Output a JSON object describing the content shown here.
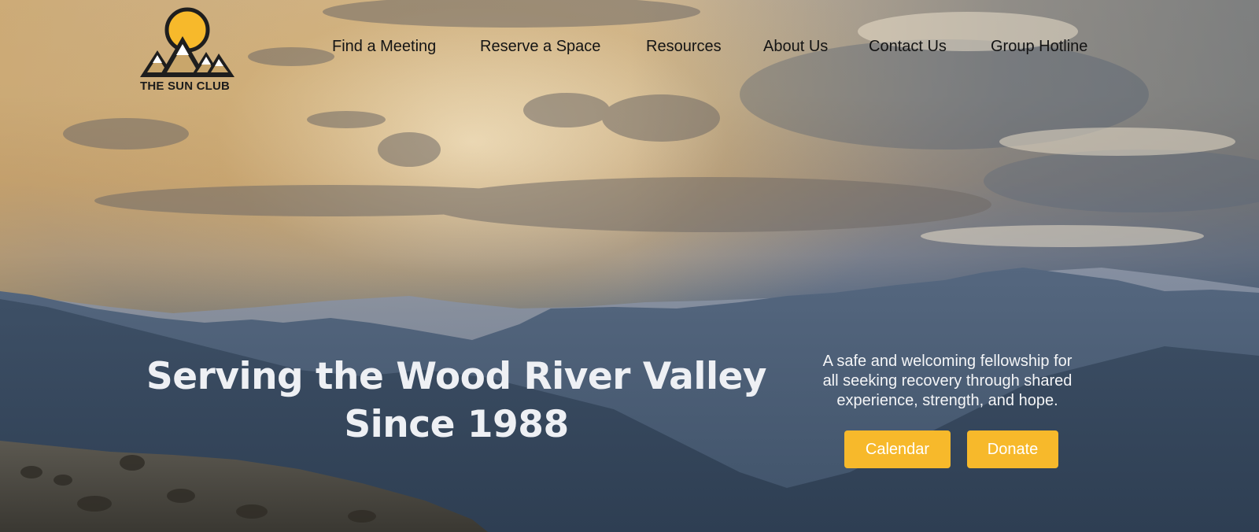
{
  "brand": {
    "name": "THE SUN CLUB",
    "colors": {
      "sun": "#f7b92b",
      "mountain": "#1e1e1e",
      "peak": "#c9a66b"
    }
  },
  "nav": {
    "items": [
      {
        "label": "Find a Meeting"
      },
      {
        "label": "Reserve a Space"
      },
      {
        "label": "Resources"
      },
      {
        "label": "About Us"
      },
      {
        "label": "Contact Us"
      },
      {
        "label": "Group Hotline"
      }
    ]
  },
  "hero": {
    "headline_line1": "Serving the Wood River Valley",
    "headline_line2": "Since 1988",
    "tagline_line1": "A safe and welcoming fellowship for",
    "tagline_line2": "all seeking recovery through shared",
    "tagline_line3": "experience, strength, and hope.",
    "buttons": {
      "calendar": "Calendar",
      "donate": "Donate"
    },
    "accent_color": "#f7b92b"
  }
}
